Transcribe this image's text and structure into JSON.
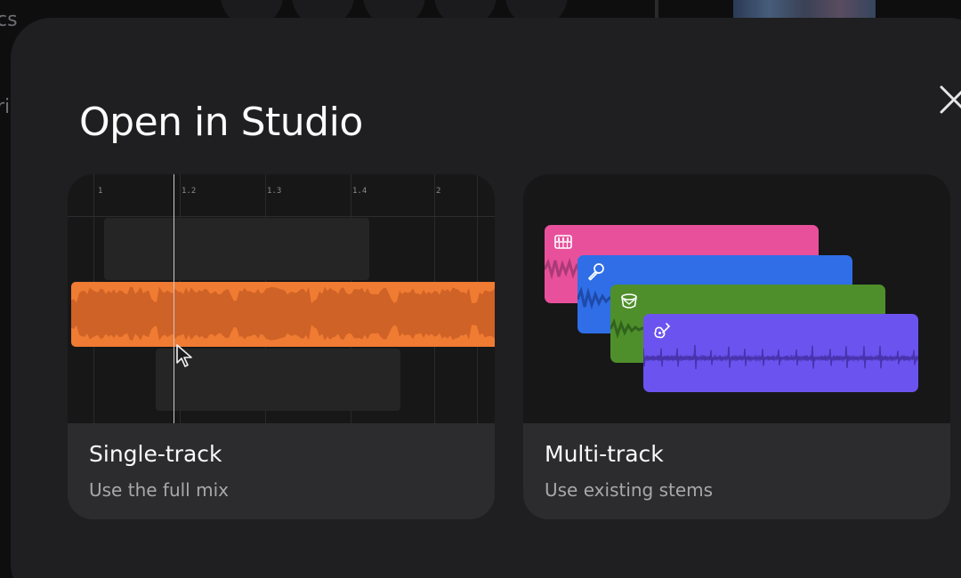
{
  "background": {
    "left_text_top": "cs",
    "left_text_mid": "ri"
  },
  "modal": {
    "title": "Open in Studio",
    "close_icon": "close-icon"
  },
  "options": [
    {
      "title": "Single-track",
      "subtitle": "Use the full mix",
      "ruler_ticks": [
        "1",
        "1.2",
        "1.3",
        "1.4",
        "2"
      ]
    },
    {
      "title": "Multi-track",
      "subtitle": "Use existing stems",
      "stems": [
        {
          "icon": "keyboard-icon",
          "color": "#e8509b"
        },
        {
          "icon": "microphone-icon",
          "color": "#2f6ee6"
        },
        {
          "icon": "drum-icon",
          "color": "#4f8f2b"
        },
        {
          "icon": "guitar-icon",
          "color": "#6b53ef"
        }
      ]
    }
  ],
  "colors": {
    "modal_bg": "#1f1f21",
    "card_bg": "#2c2c2e",
    "waveform_orange": "#f07b32"
  }
}
